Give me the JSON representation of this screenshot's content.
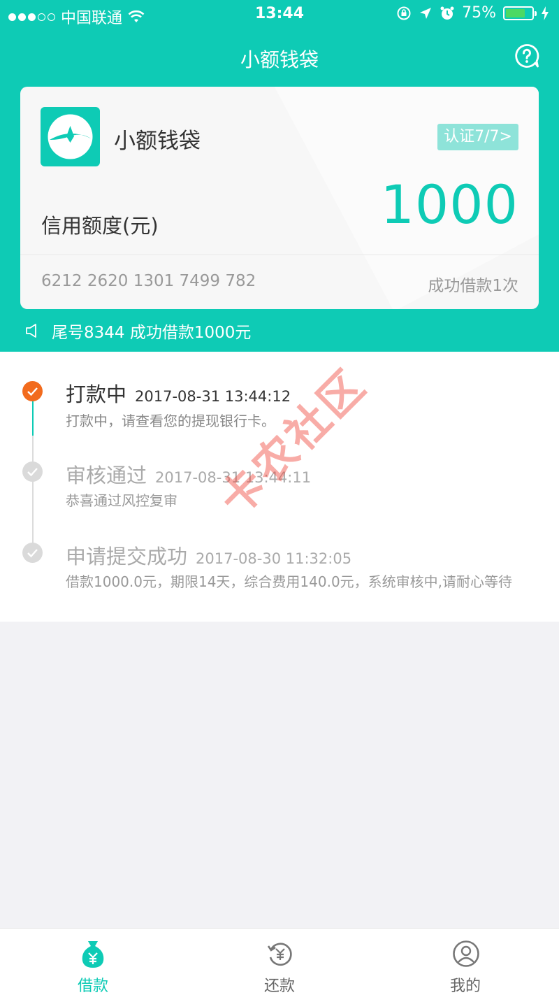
{
  "status_bar": {
    "carrier": "中国联通",
    "time": "13:44",
    "battery_percent": "75%",
    "battery_level": 0.75
  },
  "nav": {
    "title": "小额钱袋",
    "help_icon": "help-circle-icon"
  },
  "card": {
    "name": "小额钱袋",
    "cert_badge": "认证7/7>",
    "limit_label": "信用额度(元)",
    "limit_value": "1000",
    "card_number": "6212 2620 1301 7499 782",
    "success_count": "成功借款1次"
  },
  "notice": {
    "text": "尾号8344 成功借款1000元"
  },
  "timeline": [
    {
      "title": "打款中",
      "time": "2017-08-31 13:44:12",
      "desc": "打款中，请查看您的提现银行卡。",
      "state": "active"
    },
    {
      "title": "审核通过",
      "time": "2017-08-31 13:44:11",
      "desc": "恭喜通过风控复审",
      "state": "done"
    },
    {
      "title": "申请提交成功",
      "time": "2017-08-30 11:32:05",
      "desc": "借款1000.0元，期限14天，综合费用140.0元，系统审核中,请耐心等待",
      "state": "done"
    }
  ],
  "watermark": "卡农社区",
  "tabs": [
    {
      "label": "借款",
      "icon": "money-bag-icon",
      "active": true
    },
    {
      "label": "还款",
      "icon": "repay-icon",
      "active": false
    },
    {
      "label": "我的",
      "icon": "profile-icon",
      "active": false
    }
  ],
  "colors": {
    "primary": "#0ecbb5",
    "active_step": "#f26b1d",
    "done_step": "#d9d9d9"
  }
}
